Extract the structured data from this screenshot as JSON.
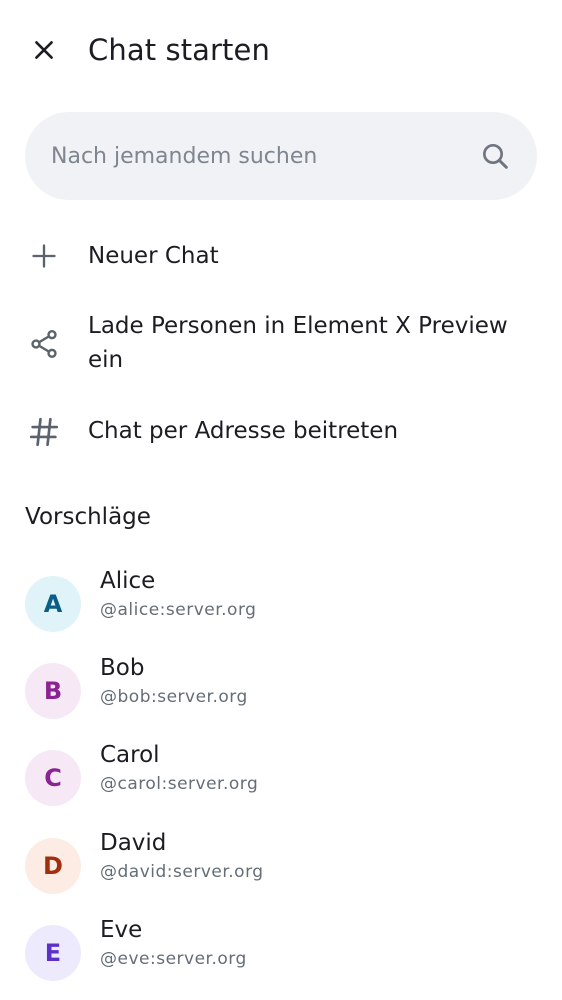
{
  "header": {
    "title": "Chat starten"
  },
  "search": {
    "placeholder": "Nach jemandem suchen",
    "value": ""
  },
  "actions": [
    {
      "label": "Neuer Chat",
      "icon": "plus-icon"
    },
    {
      "label": "Lade Personen in Element X Preview ein",
      "icon": "share-icon"
    },
    {
      "label": "Chat per Adresse beitreten",
      "icon": "hash-icon"
    }
  ],
  "suggestions": {
    "title": "Vorschläge",
    "items": [
      {
        "initial": "A",
        "name": "Alice",
        "id": "@alice:server.org",
        "bg": "#e0f3f8",
        "fg": "#0b5e86"
      },
      {
        "initial": "B",
        "name": "Bob",
        "id": "@bob:server.org",
        "bg": "#f7e8f6",
        "fg": "#8a2492"
      },
      {
        "initial": "C",
        "name": "Carol",
        "id": "@carol:server.org",
        "bg": "#f7e8f6",
        "fg": "#8a2492"
      },
      {
        "initial": "D",
        "name": "David",
        "id": "@david:server.org",
        "bg": "#fdece4",
        "fg": "#a32e0e"
      },
      {
        "initial": "E",
        "name": "Eve",
        "id": "@eve:server.org",
        "bg": "#eeeafd",
        "fg": "#5b31c9"
      }
    ]
  },
  "colors": {
    "icon": "#5b626c",
    "search_bg": "#f0f2f5",
    "secondary_text": "#656d77"
  }
}
